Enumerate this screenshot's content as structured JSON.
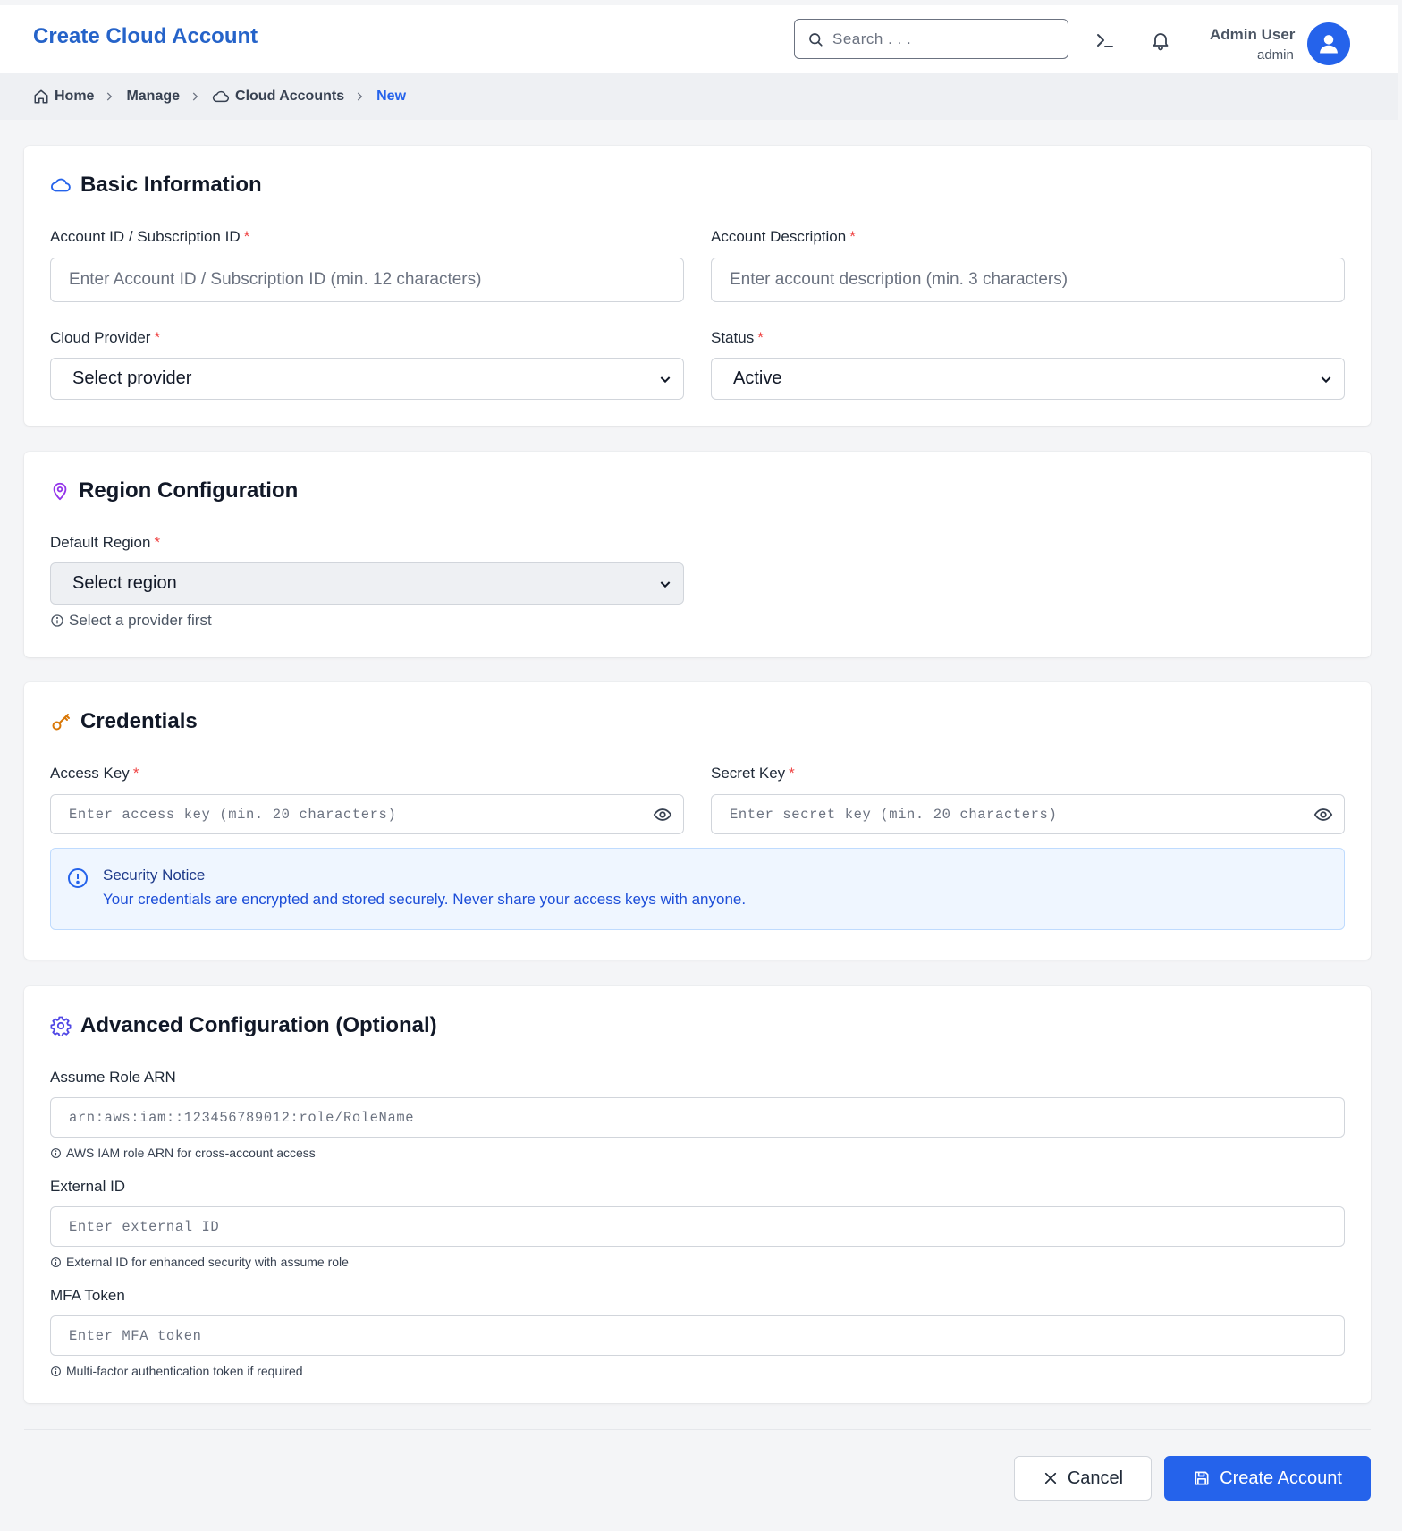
{
  "header": {
    "title": "Create Cloud Account",
    "search_placeholder": "Search . . .",
    "user_name": "Admin User",
    "user_role": "admin",
    "icons": [
      "search-icon",
      "terminal-icon",
      "bell-icon",
      "user-avatar-icon"
    ]
  },
  "breadcrumb": {
    "home": "Home",
    "manage": "Manage",
    "cloud_accounts": "Cloud Accounts",
    "current": "New"
  },
  "basic": {
    "title": "Basic Information",
    "account_id_label": "Account ID / Subscription ID",
    "account_id_placeholder": "Enter Account ID / Subscription ID (min. 12 characters)",
    "description_label": "Account Description",
    "description_placeholder": "Enter account description (min. 3 characters)",
    "provider_label": "Cloud Provider",
    "provider_value": "Select provider",
    "status_label": "Status",
    "status_value": "Active",
    "required_mark": "*"
  },
  "region": {
    "title": "Region Configuration",
    "default_region_label": "Default Region",
    "default_region_value": "Select region",
    "hint": "Select a provider first"
  },
  "credentials": {
    "title": "Credentials",
    "access_key_label": "Access Key",
    "access_key_placeholder": "Enter access key (min. 20 characters)",
    "secret_key_label": "Secret Key",
    "secret_key_placeholder": "Enter secret key (min. 20 characters)",
    "notice_title": "Security Notice",
    "notice_text": "Your credentials are encrypted and stored securely. Never share your access keys with anyone."
  },
  "advanced": {
    "title": "Advanced Configuration (Optional)",
    "arn_label": "Assume Role ARN",
    "arn_placeholder": "arn:aws:iam::123456789012:role/RoleName",
    "arn_hint": "AWS IAM role ARN for cross-account access",
    "external_id_label": "External ID",
    "external_id_placeholder": "Enter external ID",
    "external_id_hint": "External ID for enhanced security with assume role",
    "mfa_label": "MFA Token",
    "mfa_placeholder": "Enter MFA token",
    "mfa_hint": "Multi-factor authentication token if required"
  },
  "actions": {
    "cancel": "Cancel",
    "create": "Create Account"
  },
  "colors": {
    "accent": "#2563eb",
    "title_blue": "#2563c9",
    "required": "#ef4444",
    "notice_bg": "#eff6ff",
    "region_icon": "#9333ea",
    "credentials_icon": "#d97706",
    "advanced_icon": "#4f46e5"
  }
}
